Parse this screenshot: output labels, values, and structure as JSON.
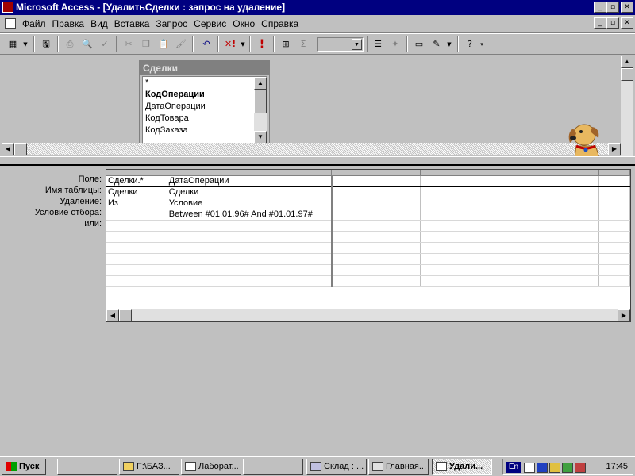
{
  "window": {
    "title": "Microsoft Access - [УдалитьСделки : запрос на удаление]",
    "controls": [
      "_",
      "▫",
      "✕"
    ]
  },
  "menu": {
    "items": [
      "Файл",
      "Правка",
      "Вид",
      "Вставка",
      "Запрос",
      "Сервис",
      "Окно",
      "Справка"
    ]
  },
  "toolbar": {
    "zoom_value": "",
    "sigma": "Σ",
    "run": "!",
    "delete_type": "✕!"
  },
  "table_window": {
    "title": "Сделки",
    "fields": [
      {
        "name": "*",
        "bold": false
      },
      {
        "name": "КодОперации",
        "bold": true
      },
      {
        "name": "ДатаОперации",
        "bold": false
      },
      {
        "name": "КодТовара",
        "bold": false
      },
      {
        "name": "КодЗаказа",
        "bold": false
      }
    ]
  },
  "grid": {
    "row_labels": [
      "Поле:",
      "Имя таблицы:",
      "Удаление:",
      "Условие отбора:",
      "или:"
    ],
    "columns": [
      {
        "field": "Сделки.*",
        "table": "Сделки",
        "delete": "Из",
        "criteria": "",
        "or": ""
      },
      {
        "field": "ДатаОперации",
        "table": "Сделки",
        "delete": "Условие",
        "criteria": "Between #01.01.96# And #01.01.97#",
        "or": ""
      },
      {
        "field": "",
        "table": "",
        "delete": "",
        "criteria": "",
        "or": ""
      },
      {
        "field": "",
        "table": "",
        "delete": "",
        "criteria": "",
        "or": ""
      },
      {
        "field": "",
        "table": "",
        "delete": "",
        "criteria": "",
        "or": ""
      },
      {
        "field": "",
        "table": "",
        "delete": "",
        "criteria": "",
        "or": ""
      }
    ]
  },
  "taskbar": {
    "start_label": "Пуск",
    "tasks": [
      {
        "label": "",
        "icon": "blank",
        "active": false
      },
      {
        "label": "F:\\БАЗ...",
        "icon": "folder-icon",
        "active": false
      },
      {
        "label": "Лаборат...",
        "icon": "word-icon",
        "active": false
      },
      {
        "label": "",
        "icon": "blank",
        "active": false
      },
      {
        "label": "Склад : ...",
        "icon": "access-db-icon",
        "active": false
      },
      {
        "label": "Главная...",
        "icon": "form-icon",
        "active": false
      },
      {
        "label": "Удали...",
        "icon": "query-icon",
        "active": true
      }
    ],
    "language": "En",
    "clock": "17:45"
  }
}
